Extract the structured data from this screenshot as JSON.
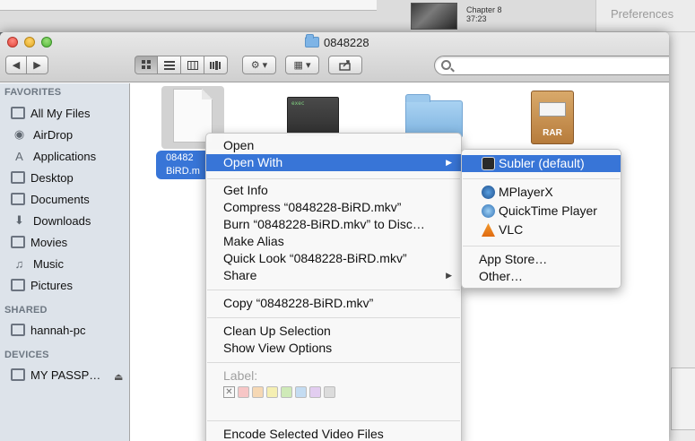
{
  "background": {
    "chapter_label": "Chapter 8",
    "chapter_time": "37:23",
    "preferences_label": "Preferences"
  },
  "window": {
    "title": "0848228"
  },
  "sidebar": {
    "favorites_header": "FAVORITES",
    "favorites": [
      {
        "label": "All My Files",
        "icon": "all-files-icon"
      },
      {
        "label": "AirDrop",
        "icon": "airdrop-icon"
      },
      {
        "label": "Applications",
        "icon": "applications-icon"
      },
      {
        "label": "Desktop",
        "icon": "desktop-icon"
      },
      {
        "label": "Documents",
        "icon": "documents-icon"
      },
      {
        "label": "Downloads",
        "icon": "downloads-icon"
      },
      {
        "label": "Movies",
        "icon": "movies-icon"
      },
      {
        "label": "Music",
        "icon": "music-icon"
      },
      {
        "label": "Pictures",
        "icon": "pictures-icon"
      }
    ],
    "shared_header": "SHARED",
    "shared": [
      {
        "label": "hannah-pc",
        "icon": "computer-icon"
      }
    ],
    "devices_header": "DEVICES",
    "devices": [
      {
        "label": "MY PASSP…",
        "icon": "drive-icon"
      }
    ]
  },
  "files": {
    "selected_file_label_line1": "08482",
    "selected_file_label_line2": "BiRD.m",
    "rar_badge": "RAR"
  },
  "context_menu": {
    "items": {
      "open": "Open",
      "open_with": "Open With",
      "get_info": "Get Info",
      "compress": "Compress “0848228-BiRD.mkv”",
      "burn": "Burn “0848228-BiRD.mkv” to Disc…",
      "make_alias": "Make Alias",
      "quick_look": "Quick Look “0848228-BiRD.mkv”",
      "share": "Share",
      "copy": "Copy “0848228-BiRD.mkv”",
      "clean_up": "Clean Up Selection",
      "show_view_options": "Show View Options",
      "label_header": "Label:",
      "encode": "Encode Selected Video Files"
    },
    "label_colors": [
      "#f7c6c6",
      "#f6d8b4",
      "#f5efb2",
      "#cfeab8",
      "#c4dcf2",
      "#e2cdf0",
      "#dcdcdc"
    ]
  },
  "open_with_submenu": {
    "default_app": "Subler (default)",
    "apps": [
      "MPlayerX",
      "QuickTime Player",
      "VLC"
    ],
    "app_store": "App Store…",
    "other": "Other…"
  },
  "colors": {
    "highlight": "#3875d7",
    "sidebar_bg": "#dde3ea"
  }
}
